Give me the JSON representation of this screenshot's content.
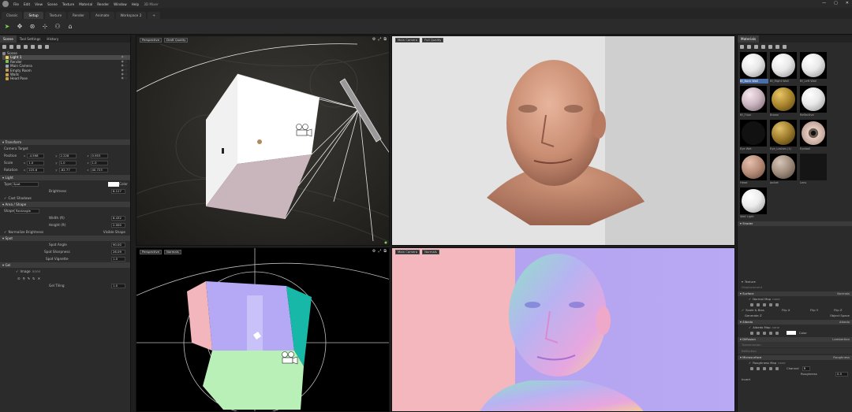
{
  "window": {
    "title": "3D Mixer",
    "controls": [
      "—",
      "▢",
      "✕"
    ]
  },
  "menu": [
    "File",
    "Edit",
    "View",
    "Scene",
    "Texture",
    "Material",
    "Render",
    "Window",
    "Help"
  ],
  "workspace_tabs": [
    "Classic",
    "Setup",
    "Texture",
    "Render",
    "Animate",
    "Workspace 2",
    "+"
  ],
  "left_panel": {
    "tabs": [
      "Scene",
      "Tool Settings",
      "History"
    ],
    "tree": [
      {
        "label": "Scene",
        "color": "#888888"
      },
      {
        "label": "Light 1",
        "color": "#f2d14b"
      },
      {
        "label": "Render",
        "color": "#7fbf5b"
      },
      {
        "label": "Main Camera",
        "color": "#9aa8b5"
      },
      {
        "label": "Empty Room",
        "color": "#c9a04a"
      },
      {
        "label": "Walls",
        "color": "#c9a04a"
      },
      {
        "label": "Head Pose",
        "color": "#c9a04a"
      }
    ],
    "transform": {
      "header": "Transform",
      "target": "Camera Target",
      "rows": [
        {
          "label": "Position",
          "x": "-4.598",
          "y": "2.228",
          "z": "0.953"
        },
        {
          "label": "Scale",
          "x": "1.0",
          "y": "1.0",
          "z": "1.0"
        },
        {
          "label": "Rotation",
          "x": "225.6",
          "y": "-62.77",
          "z": "40.723"
        }
      ]
    },
    "light": {
      "header": "Light",
      "type_label": "Type",
      "type_value": "Spot",
      "color_label": "Color",
      "brightness_label": "Brightness",
      "brightness_value": "8.127",
      "cast_shadows": "Cast Shadows"
    },
    "area_shape": {
      "header": "Area / Shape",
      "shape_label": "Shape",
      "shape_value": "Rectangle",
      "width_label": "Width (ft)",
      "width_value": "8.432",
      "height_label": "Height (ft)",
      "height_value": "2.000",
      "normalize": "Normalize Brightness",
      "visible": "Visible Shape"
    },
    "spot": {
      "header": "Spot",
      "angle_label": "Spot Angle",
      "angle_value": "90.00",
      "sharpness_label": "Spot Sharpness",
      "sharpness_value": "26.09",
      "vignette_label": "Spot Vignette",
      "vignette_value": "1.0"
    },
    "gel": {
      "header": "Gel",
      "image_label": "Image",
      "image_value": "none",
      "tiling_label": "Gel Tiling",
      "tiling_value": "1.0"
    }
  },
  "viewports": [
    {
      "camera": "Perspective",
      "mode": "Draft Quality"
    },
    {
      "camera": "Main Camera",
      "mode": "Full Quality"
    },
    {
      "camera": "Perspective",
      "mode": "Normals"
    },
    {
      "camera": "Main Camera",
      "mode": "Normals"
    }
  ],
  "right_panel": {
    "header": "Materials",
    "materials": [
      {
        "name": "Bf_Back Wall",
        "color": "#e8e8e8",
        "selected": true
      },
      {
        "name": "Bf_Right Wall",
        "color": "#e8e8e8",
        "selected": false
      },
      {
        "name": "Bf_Left Wall",
        "color": "#e8e8e8",
        "selected": false
      },
      {
        "name": "Bf_Floor",
        "color": "#cdb8c2",
        "selected": false
      },
      {
        "name": "Brown",
        "color": "#a8842c",
        "selected": false
      },
      {
        "name": "Reflective",
        "color": "#e8e8e8",
        "selected": false
      },
      {
        "name": "Eye Wet",
        "color": "#111111",
        "selected": false
      },
      {
        "name": "Eye_Lashes (1)",
        "color": "#9a7a2a",
        "selected": false
      },
      {
        "name": "Eyeball",
        "color": "#c9a79a",
        "selected": false
      },
      {
        "name": "Head",
        "color": "#b58a76",
        "selected": false
      },
      {
        "name": "Jacket",
        "color": "#9e8a7a",
        "selected": false
      },
      {
        "name": "Lens",
        "color": "#151515",
        "selected": false
      },
      {
        "name": "Wall Light",
        "color": "#ececec",
        "selected": false
      }
    ],
    "shader_header": "Shader",
    "texture_label": "Texture",
    "displacement": "Displacement",
    "surface": {
      "label": "Surface",
      "value": "Normals"
    },
    "normal_map": {
      "label": "Normal Map",
      "value": "none"
    },
    "scale_bias": "Scale & Bias",
    "flip_x": "Flip X",
    "flip_y": "Flip Y",
    "flip_z": "Flip Z",
    "generate": "Generate Z",
    "object_space": "Object Space",
    "albedo": {
      "label": "Albedo",
      "value": "Albedo"
    },
    "albedo_map": {
      "label": "Albedo Map",
      "value": "none"
    },
    "albedo_color": "Color",
    "diffusion": {
      "label": "Diffusion",
      "value": "Lambertian"
    },
    "transmission": "Transmission",
    "reflection": "Reflection",
    "microsurface": {
      "label": "Microsurface",
      "value": "Roughness"
    },
    "roughness_map": {
      "label": "Roughness Map",
      "value": "none"
    },
    "channel": {
      "label": "Channel",
      "value": "R"
    },
    "roughness": {
      "label": "Roughness",
      "value": "0.5"
    },
    "invert": "Invert"
  }
}
